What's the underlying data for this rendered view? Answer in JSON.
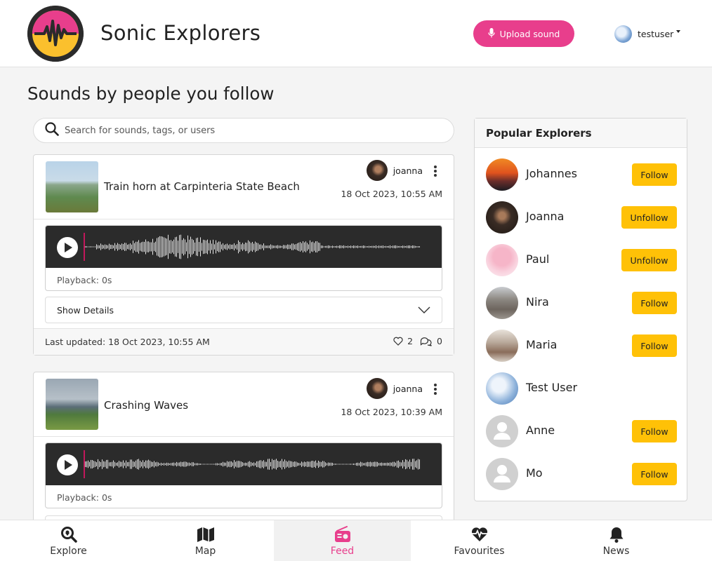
{
  "header": {
    "app_title": "Sonic Explorers",
    "upload_label": "Upload sound",
    "username": "testuser"
  },
  "page_title": "Sounds by people you follow",
  "search": {
    "placeholder": "Search for sounds, tags, or users"
  },
  "sounds": [
    {
      "title": "Train horn at Carpinteria State Beach",
      "author": "joanna",
      "date": "18 Oct 2023, 10:55 AM",
      "playback": "Playback: 0s",
      "details_label": "Show Details",
      "last_updated": "Last updated: 18 Oct 2023, 10:55 AM",
      "likes": "2",
      "comments": "0"
    },
    {
      "title": "Crashing Waves",
      "author": "joanna",
      "date": "18 Oct 2023, 10:39 AM",
      "playback": "Playback: 0s"
    }
  ],
  "popular": {
    "title": "Popular Explorers",
    "explorers": [
      {
        "name": "Johannes",
        "action": "Follow"
      },
      {
        "name": "Joanna",
        "action": "Unfollow"
      },
      {
        "name": "Paul",
        "action": "Unfollow"
      },
      {
        "name": "Nira",
        "action": "Follow"
      },
      {
        "name": "Maria",
        "action": "Follow"
      },
      {
        "name": "Test User",
        "action": ""
      },
      {
        "name": "Anne",
        "action": "Follow"
      },
      {
        "name": "Mo",
        "action": "Follow"
      }
    ]
  },
  "nav": [
    {
      "label": "Explore",
      "icon": "search-location-icon"
    },
    {
      "label": "Map",
      "icon": "map-icon"
    },
    {
      "label": "Feed",
      "icon": "radio-icon",
      "active": true
    },
    {
      "label": "Favourites",
      "icon": "heartbeat-icon"
    },
    {
      "label": "News",
      "icon": "bell-icon"
    }
  ],
  "colors": {
    "accent": "#e83e8c",
    "follow": "#ffc107",
    "waveform_bg": "#2b2b2b"
  }
}
